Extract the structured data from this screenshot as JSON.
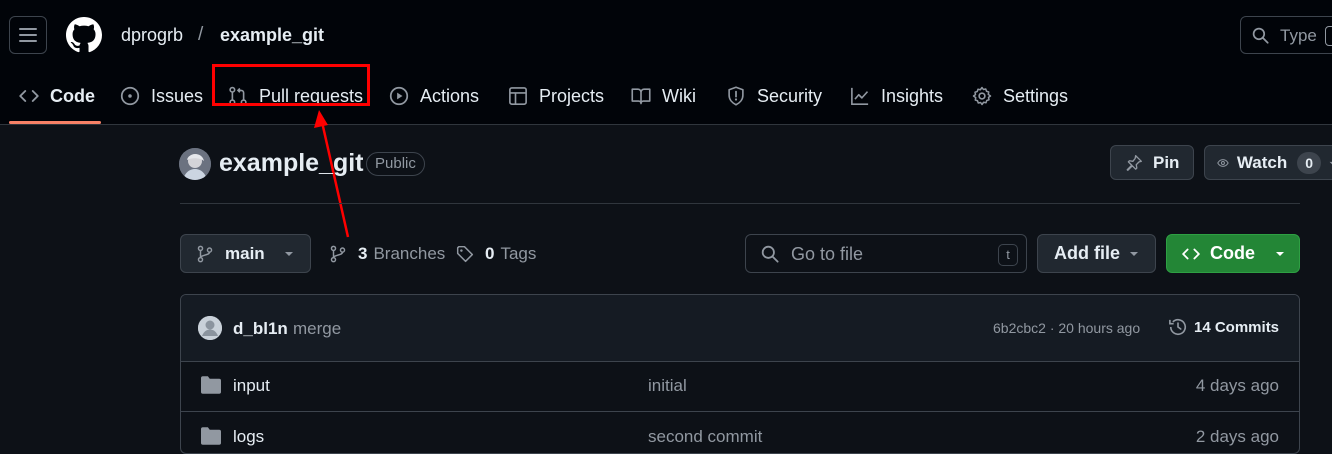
{
  "header": {
    "owner": "dprogrb",
    "separator": "/",
    "repo": "example_git",
    "search_placeholder": "Type",
    "search_shortcut": "/"
  },
  "tabs": [
    {
      "label": "Code",
      "icon": "code-icon"
    },
    {
      "label": "Issues",
      "icon": "issue-icon"
    },
    {
      "label": "Pull requests",
      "icon": "pull-request-icon"
    },
    {
      "label": "Actions",
      "icon": "play-icon"
    },
    {
      "label": "Projects",
      "icon": "table-icon"
    },
    {
      "label": "Wiki",
      "icon": "book-icon"
    },
    {
      "label": "Security",
      "icon": "shield-icon"
    },
    {
      "label": "Insights",
      "icon": "graph-icon"
    },
    {
      "label": "Settings",
      "icon": "gear-icon"
    }
  ],
  "repo": {
    "name": "example_git",
    "visibility": "Public",
    "pin_label": "Pin",
    "watch_label": "Watch",
    "watch_count": "0"
  },
  "toolbar": {
    "branch": "main",
    "branches_count": "3",
    "branches_label": "Branches",
    "tags_count": "0",
    "tags_label": "Tags",
    "go_to_file": "Go to file",
    "go_to_file_shortcut": "t",
    "add_file": "Add file",
    "code": "Code"
  },
  "latest_commit": {
    "author": "d_bl1n",
    "message": "merge",
    "hash_time": "6b2cbc2 · 20 hours ago",
    "commits_label": "14 Commits"
  },
  "files": [
    {
      "name": "input",
      "message": "initial",
      "age": "4 days ago"
    },
    {
      "name": "logs",
      "message": "second commit",
      "age": "2 days ago"
    }
  ],
  "colors": {
    "background": "#0d1117",
    "header": "#010409",
    "highlight": "#ff0000",
    "code_button": "#238636",
    "active_tab": "#f78166"
  }
}
